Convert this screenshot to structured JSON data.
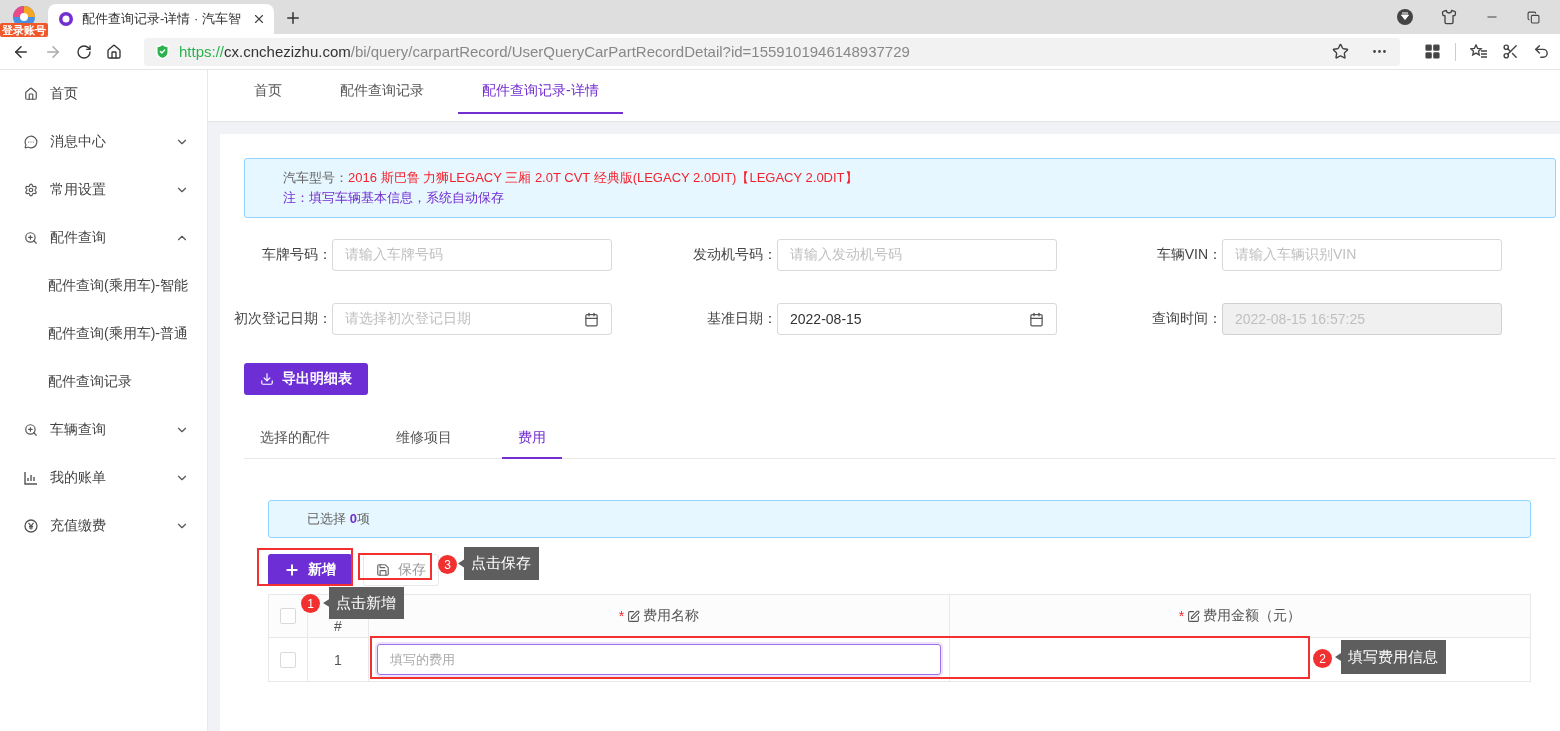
{
  "browser": {
    "badge": "登录账号",
    "tab_title": "配件查询记录-详情 · 汽车智",
    "url": {
      "scheme": "https://",
      "host": "cx.cnchezizhu.com",
      "path": "/bi/query/carpartRecord/UserQueryCarPartRecordDetail?id=1559101946148937729"
    }
  },
  "sidebar": {
    "items": [
      {
        "label": "首页",
        "kind": "link"
      },
      {
        "label": "消息中心",
        "kind": "group",
        "expanded": false
      },
      {
        "label": "常用设置",
        "kind": "group",
        "expanded": false
      },
      {
        "label": "配件查询",
        "kind": "group",
        "expanded": true,
        "children": [
          {
            "label": "配件查询(乘用车)-智能"
          },
          {
            "label": "配件查询(乘用车)-普通"
          },
          {
            "label": "配件查询记录"
          }
        ]
      },
      {
        "label": "车辆查询",
        "kind": "group",
        "expanded": false
      },
      {
        "label": "我的账单",
        "kind": "group",
        "expanded": false
      },
      {
        "label": "充值缴费",
        "kind": "group",
        "expanded": false
      }
    ]
  },
  "page_tabs": [
    {
      "label": "首页",
      "selected": false
    },
    {
      "label": "配件查询记录",
      "selected": false
    },
    {
      "label": "配件查询记录-详情",
      "selected": true
    }
  ],
  "vehicle_alert": {
    "label": "汽车型号：",
    "model": "2016 斯巴鲁 力狮LEGACY 三厢 2.0T CVT 经典版(LEGACY 2.0DIT)【LEGACY 2.0DIT】",
    "note": "注：填写车辆基本信息，系统自动保存"
  },
  "form_fields": [
    {
      "label": "车牌号码：",
      "kind": "text",
      "placeholder": "请输入车牌号码",
      "disabled": false
    },
    {
      "label": "发动机号码：",
      "kind": "text",
      "placeholder": "请输入发动机号码",
      "disabled": false
    },
    {
      "label": "车辆VIN：",
      "kind": "text",
      "placeholder": "请输入车辆识别VIN",
      "disabled": false
    },
    {
      "label": "初次登记日期：",
      "kind": "date",
      "placeholder": "请选择初次登记日期",
      "disabled": false
    },
    {
      "label": "基准日期：",
      "kind": "date",
      "value": "2022-08-15",
      "disabled": false
    },
    {
      "label": "查询时间：",
      "kind": "text",
      "value": "2022-08-15 16:57:25",
      "disabled": true
    }
  ],
  "export_button": "导出明细表",
  "detail_tabs": [
    {
      "label": "选择的配件",
      "selected": false
    },
    {
      "label": "维修项目",
      "selected": false
    },
    {
      "label": "费用",
      "selected": true
    }
  ],
  "selection_info": "已选择 **0**项",
  "toolbar": {
    "add_button": "新增",
    "save_button": "保存"
  },
  "table": {
    "header_checked": false,
    "columns": [
      {
        "label": "#",
        "editable": false
      },
      {
        "label": "费用名称",
        "required_mark": "*",
        "editable": true
      },
      {
        "label": "费用金额（元）",
        "required_mark": "*",
        "editable": true
      }
    ],
    "rows": [
      {
        "index": "1",
        "checked": false,
        "name_placeholder": "填写的费用"
      }
    ]
  },
  "annotations": [
    {
      "number": "1",
      "text": "点击新增"
    },
    {
      "number": "2",
      "text": "填写费用信息"
    },
    {
      "number": "3",
      "text": "点击保存"
    }
  ]
}
